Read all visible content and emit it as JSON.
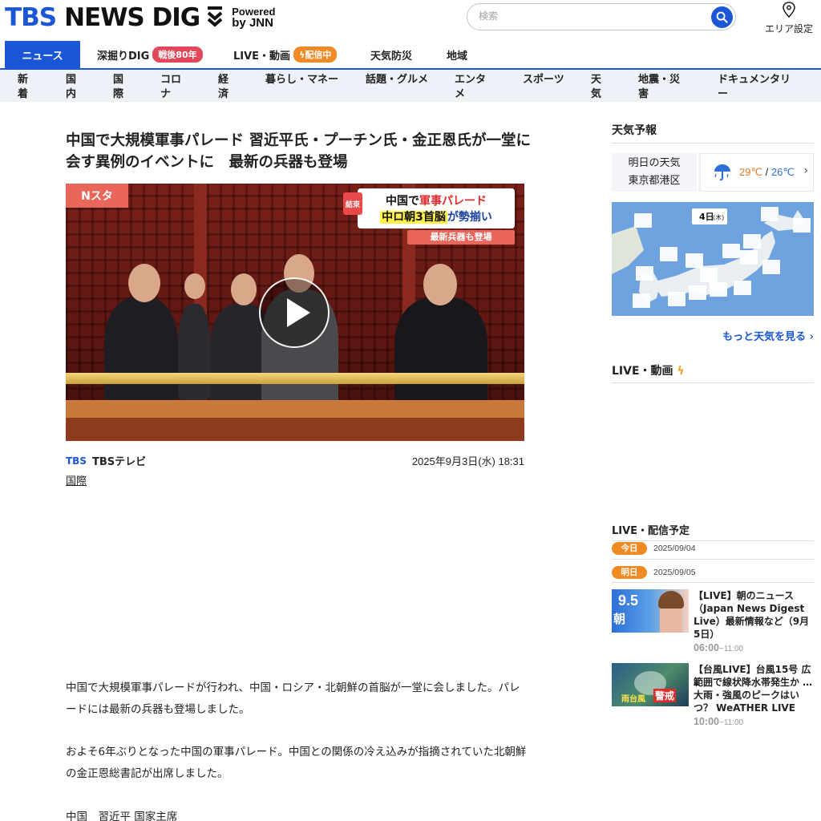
{
  "header": {
    "logo_tbs": "TBS",
    "logo_newsdig": "NEWS DIG",
    "powered_1": "Powered",
    "powered_2": "by JNN",
    "search_placeholder": "検索",
    "area_label": "エリア設定"
  },
  "mainnav": [
    {
      "label": "ニュース",
      "active": true
    },
    {
      "label": "深掘りDIG",
      "badge": "戦後80年"
    },
    {
      "label": "LIVE・動画",
      "badge": "配信中"
    },
    {
      "label": "天気防災"
    },
    {
      "label": "地域"
    }
  ],
  "subnav": [
    "新着",
    "国内",
    "国際",
    "コロナ",
    "経済",
    "暮らし・マネー",
    "話題・グルメ",
    "エンタメ",
    "スポーツ",
    "天気",
    "地震・災害",
    "ドキュメンタリー"
  ],
  "article": {
    "title": "中国で大規模軍事パレード 習近平氏・プーチン氏・金正恩氏が一堂に会す異例のイベントに　最新の兵器も登場",
    "video": {
      "corner_label": "Nスタ",
      "tag": "結束",
      "line1_a": "中国で",
      "line1_b": "軍事パレード",
      "line2_a": "中ロ朝3首脳",
      "line2_b": "が勢揃い",
      "sub": "最新兵器も登場"
    },
    "source_logo": "TBS",
    "source": "TBSテレビ",
    "date": "2025年9月3日(水) 18:31",
    "category": "国際",
    "para1": "中国で大規模軍事パレードが行われ、中国・ロシア・北朝鮮の首脳が一堂に会しました。パレードには最新の兵器も登場しました。",
    "para2": "およそ6年ぶりとなった中国の軍事パレード。中国との関係の冷え込みが指摘されていた北朝鮮の金正恩総書記が出席しました。",
    "para3": "中国　習近平 国家主席"
  },
  "sidebar": {
    "weather_heading": "天気予報",
    "weather_day": "明日の天気",
    "weather_place": "東京都港区",
    "temp_hi": "29℃",
    "temp_sep": " / ",
    "temp_lo": "26℃",
    "map_date": "4日",
    "map_weekday": "(木)",
    "more_weather": "もっと天気を見る",
    "live_heading": "LIVE・動画",
    "schedule_heading": "LIVE・配信予定",
    "schedule": [
      {
        "badge": "今日",
        "date": "2025/09/04"
      },
      {
        "badge": "明日",
        "date": "2025/09/05"
      }
    ],
    "items": [
      {
        "title": "【LIVE】朝のニュース（Japan News Digest Live）最新情報など（9月5日）",
        "start": "06:00",
        "end": "~11:00",
        "thumb_big": "9.5",
        "thumb_small": "朝"
      },
      {
        "title": "【台風LIVE】台風15号 広範囲で線状降水帯発生か …大雨・強風のピークはいつ？ WeATHER LIVE",
        "start": "10:00",
        "end": "~11:00",
        "thumb_caption": "雨台風",
        "thumb_warn": "警戒"
      }
    ]
  },
  "colors": {
    "brand": "#1a56d6",
    "orange": "#f08a24",
    "pink": "#e2475a"
  }
}
